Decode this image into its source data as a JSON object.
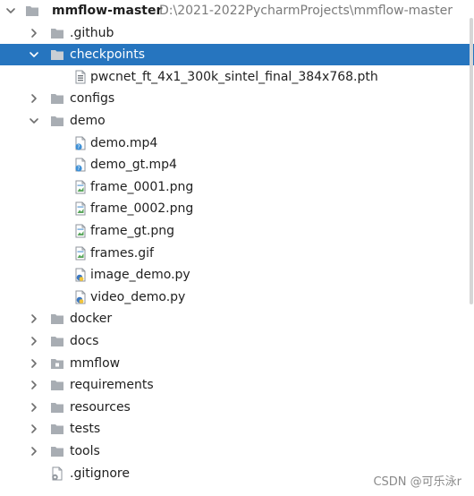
{
  "tree": [
    {
      "label": "mmflow-master",
      "path": "D:\\2021-2022PycharmProjects\\mmflow-master",
      "depth": 0,
      "icon": "folder-icon",
      "chevron": "down",
      "bold": true
    },
    {
      "label": ".github",
      "depth": 1,
      "icon": "folder-icon",
      "chevron": "right"
    },
    {
      "label": "checkpoints",
      "depth": 1,
      "icon": "folder-icon",
      "chevron": "down",
      "selected": true
    },
    {
      "label": "pwcnet_ft_4x1_300k_sintel_final_384x768.pth",
      "depth": 2,
      "icon": "binary-file-icon"
    },
    {
      "label": "configs",
      "depth": 1,
      "icon": "folder-icon",
      "chevron": "right"
    },
    {
      "label": "demo",
      "depth": 1,
      "icon": "folder-icon",
      "chevron": "down"
    },
    {
      "label": "demo.mp4",
      "depth": 2,
      "icon": "unknown-file-icon"
    },
    {
      "label": "demo_gt.mp4",
      "depth": 2,
      "icon": "unknown-file-icon"
    },
    {
      "label": "frame_0001.png",
      "depth": 2,
      "icon": "image-file-icon"
    },
    {
      "label": "frame_0002.png",
      "depth": 2,
      "icon": "image-file-icon"
    },
    {
      "label": "frame_gt.png",
      "depth": 2,
      "icon": "image-file-icon"
    },
    {
      "label": "frames.gif",
      "depth": 2,
      "icon": "image-file-icon"
    },
    {
      "label": "image_demo.py",
      "depth": 2,
      "icon": "python-file-icon"
    },
    {
      "label": "video_demo.py",
      "depth": 2,
      "icon": "python-file-icon"
    },
    {
      "label": "docker",
      "depth": 1,
      "icon": "folder-icon",
      "chevron": "right"
    },
    {
      "label": "docs",
      "depth": 1,
      "icon": "folder-icon",
      "chevron": "right"
    },
    {
      "label": "mmflow",
      "depth": 1,
      "icon": "package-folder-icon",
      "chevron": "right"
    },
    {
      "label": "requirements",
      "depth": 1,
      "icon": "folder-icon",
      "chevron": "right"
    },
    {
      "label": "resources",
      "depth": 1,
      "icon": "folder-icon",
      "chevron": "right"
    },
    {
      "label": "tests",
      "depth": 1,
      "icon": "folder-icon",
      "chevron": "right"
    },
    {
      "label": "tools",
      "depth": 1,
      "icon": "folder-icon",
      "chevron": "right"
    },
    {
      "label": ".gitignore",
      "depth": 1,
      "icon": "gitignore-file-icon"
    }
  ],
  "watermark": "CSDN @可乐泳r",
  "colors": {
    "selection": "#2675bf",
    "folder": "#a8adb3",
    "text": "#1f1f1f",
    "path_text": "#7a7a7a",
    "python_blue": "#3c78c2",
    "python_yellow": "#f0c43c"
  }
}
